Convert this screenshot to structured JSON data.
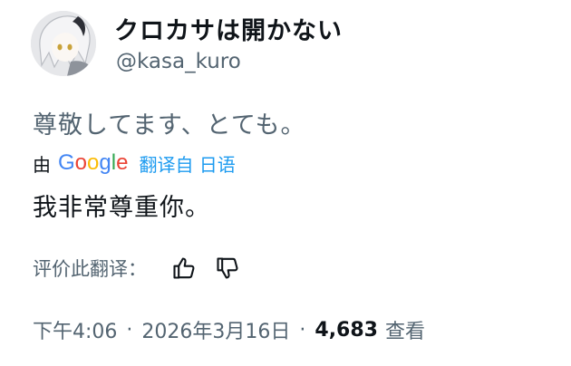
{
  "author": {
    "display_name": "クロカサは開かない",
    "handle": "@kasa_kuro"
  },
  "tweet": {
    "original_text": "尊敬してます、とても。",
    "translation_by": "由",
    "translation_provider": "Google",
    "translation_source": "翻译自 日语",
    "translated_text": "我非常尊重你。"
  },
  "rating": {
    "label": "评价此翻译：",
    "thumbs_up_icon": "thumbs-up-icon",
    "thumbs_down_icon": "thumbs-down-icon"
  },
  "meta": {
    "time": "下午4:06",
    "separator": "·",
    "date": "2026年3月16日",
    "views_count": "4,683",
    "views_label": "查看"
  },
  "colors": {
    "text_primary": "#0f1419",
    "text_secondary": "#536471",
    "link": "#1d9bf0",
    "google_blue": "#4285F4",
    "google_red": "#EA4335",
    "google_yellow": "#FBBC05",
    "google_green": "#34A853"
  }
}
